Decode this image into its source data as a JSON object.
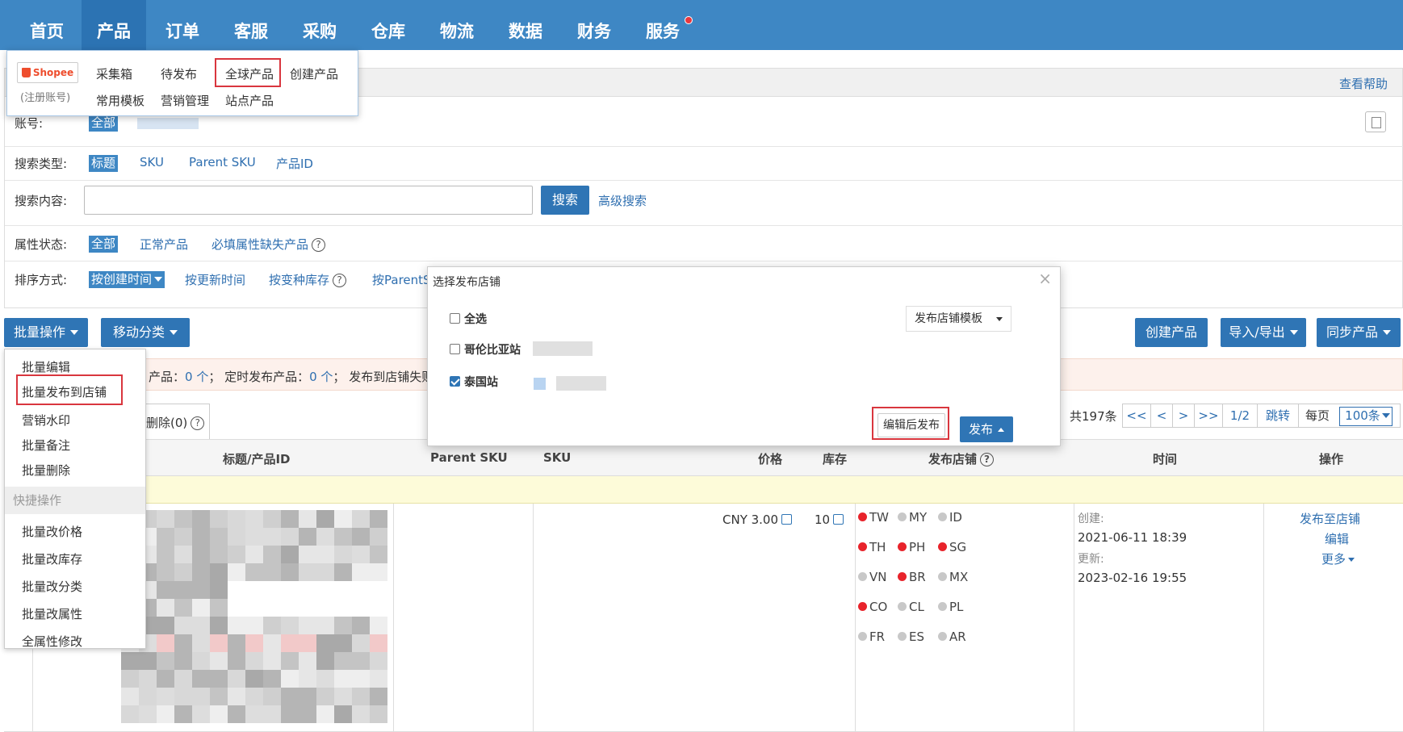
{
  "nav": {
    "items": [
      "首页",
      "产品",
      "订单",
      "客服",
      "采购",
      "仓库",
      "物流",
      "数据",
      "财务",
      "服务"
    ],
    "active": "产品"
  },
  "product_menu": {
    "brand": "Shopee",
    "brand_note": "(注册账号)",
    "row1": [
      "采集箱",
      "待发布",
      "全球产品",
      "创建产品"
    ],
    "row2": [
      "常用模板",
      "营销管理",
      "站点产品"
    ]
  },
  "help_link": "查看帮助",
  "filters": {
    "account_label": "账号:",
    "account_all": "全部",
    "search_type_label": "搜索类型:",
    "search_types": [
      "标题",
      "SKU",
      "Parent SKU",
      "产品ID"
    ],
    "search_content_label": "搜索内容:",
    "search_input_value": "",
    "search_button": "搜索",
    "advanced_search": "高级搜索",
    "attr_status_label": "属性状态:",
    "attr_all": "全部",
    "attr_normal": "正常产品",
    "attr_missing": "必填属性缺失产品",
    "sort_label": "排序方式:",
    "sort_create": "按创建时间",
    "sort_update": "按更新时间",
    "sort_stock": "按变种库存",
    "sort_parent": "按ParentS"
  },
  "toolbar": {
    "batch": "批量操作",
    "move_category": "移动分类",
    "create_product": "创建产品",
    "import_export": "导入/导出",
    "sync_products": "同步产品"
  },
  "notice": {
    "text": "产品：",
    "count1": "0 个",
    "scheduled": "；  定时发布产品：",
    "count2": "0 个",
    "failed": "；  发布到店铺失败"
  },
  "tab": {
    "label": "删除(0)"
  },
  "pagination": {
    "total": "共197条",
    "first": "<<",
    "prev": "<",
    "next": ">",
    "last": ">>",
    "page": "1/2",
    "jump": "跳转",
    "per_page_label": "每页",
    "per_page_value": "100条"
  },
  "table": {
    "headers": [
      "标题/产品ID",
      "Parent SKU",
      "SKU",
      "价格",
      "库存",
      "发布店铺",
      "时间",
      "操作"
    ],
    "row": {
      "price": "CNY  3.00",
      "stock": "10",
      "sites": [
        {
          "code": "TW",
          "active": true
        },
        {
          "code": "MY",
          "active": false
        },
        {
          "code": "ID",
          "active": false
        },
        {
          "code": "TH",
          "active": true
        },
        {
          "code": "PH",
          "active": true
        },
        {
          "code": "SG",
          "active": true
        },
        {
          "code": "VN",
          "active": false
        },
        {
          "code": "BR",
          "active": true
        },
        {
          "code": "MX",
          "active": false
        },
        {
          "code": "CO",
          "active": true
        },
        {
          "code": "CL",
          "active": false
        },
        {
          "code": "PL",
          "active": false
        },
        {
          "code": "FR",
          "active": false
        },
        {
          "code": "ES",
          "active": false
        },
        {
          "code": "AR",
          "active": false
        }
      ],
      "created_label": "创建:",
      "created": "2021-06-11 18:39",
      "updated_label": "更新:",
      "updated": "2023-02-16 19:55",
      "op_publish": "发布至店铺",
      "op_edit": "编辑",
      "op_more": "更多"
    }
  },
  "batch_menu": {
    "items_top": [
      "批量编辑",
      "批量发布到店铺",
      "营销水印",
      "批量备注",
      "批量删除"
    ],
    "group": "快捷操作",
    "items_bottom": [
      "批量改价格",
      "批量改库存",
      "批量改分类",
      "批量改属性",
      "全属性修改"
    ]
  },
  "dialog": {
    "title": "选择发布店铺",
    "close": "×",
    "select_all": "全选",
    "colombia": "哥伦比亚站",
    "thailand": "泰国站",
    "template": "发布店铺模板",
    "edit_publish": "编辑后发布",
    "publish": "发布"
  },
  "colors": {
    "nav_bg": "#3e87c4",
    "primary": "#2f75b5",
    "link": "#2f6fb0",
    "highlight_box": "#d9363e",
    "site_active": "#e8232b",
    "site_inactive": "#c8c8c8"
  }
}
